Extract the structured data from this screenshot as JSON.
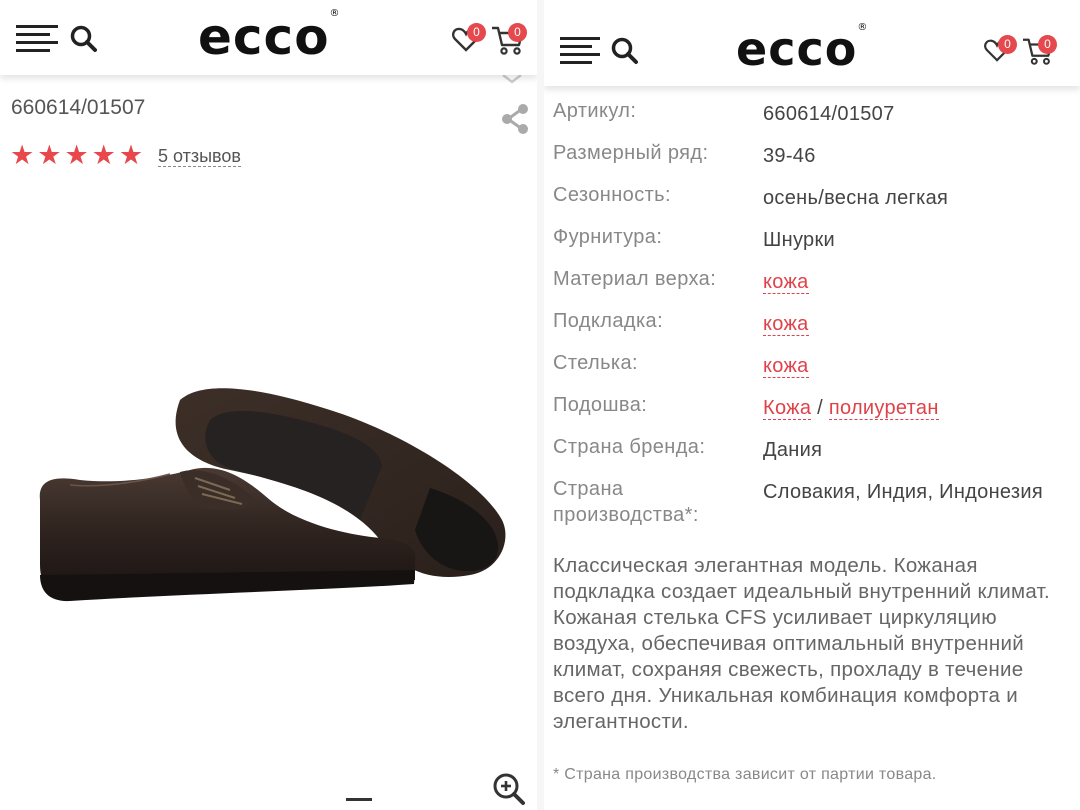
{
  "header": {
    "logo": "ecco",
    "logo_mark": "®",
    "wishlist_count": "0",
    "cart_count": "0"
  },
  "product": {
    "sku": "660614/01507",
    "rating_stars": 5,
    "reviews_label": "5 отзывов"
  },
  "specs": {
    "article": {
      "label": "Артикул:",
      "value": "660614/01507"
    },
    "size_range": {
      "label": "Размерный ряд:",
      "value": "39-46"
    },
    "season": {
      "label": "Сезонность:",
      "value": "осень/весна легкая"
    },
    "fittings": {
      "label": "Фурнитура:",
      "value": "Шнурки"
    },
    "upper": {
      "label": "Материал верха:",
      "value": "кожа"
    },
    "lining": {
      "label": "Подкладка:",
      "value": "кожа"
    },
    "insole": {
      "label": "Стелька:",
      "value": "кожа"
    },
    "sole": {
      "label": "Подошва:",
      "value_1": "Кожа",
      "sep": "/",
      "value_2": "полиуретан"
    },
    "brand_country": {
      "label": "Страна бренда:",
      "value": "Дания"
    },
    "made_in": {
      "label_1": "Страна",
      "label_2": "производства*:",
      "value": "Словакия, Индия, Индонезия"
    }
  },
  "description": "Классическая элегантная модель. Кожаная подкладка создает идеальный внутренний климат. Кожаная стелька CFS усиливает циркуляцию воздуха, обеспечивая оптимальный внутренний климат, сохраняя свежесть, прохладу в течение всего дня. Уникальная комбинация комфорта и элегантности.",
  "footnote": "* Страна производства зависит от партии товара.",
  "colors": {
    "accent": "#e5484d",
    "star": "#e8474c",
    "link": "#e0424a"
  },
  "icons": [
    "menu-icon",
    "search-icon",
    "heart-icon",
    "cart-icon",
    "share-icon",
    "zoom-in-icon",
    "chevron-down-icon",
    "star-icon"
  ]
}
